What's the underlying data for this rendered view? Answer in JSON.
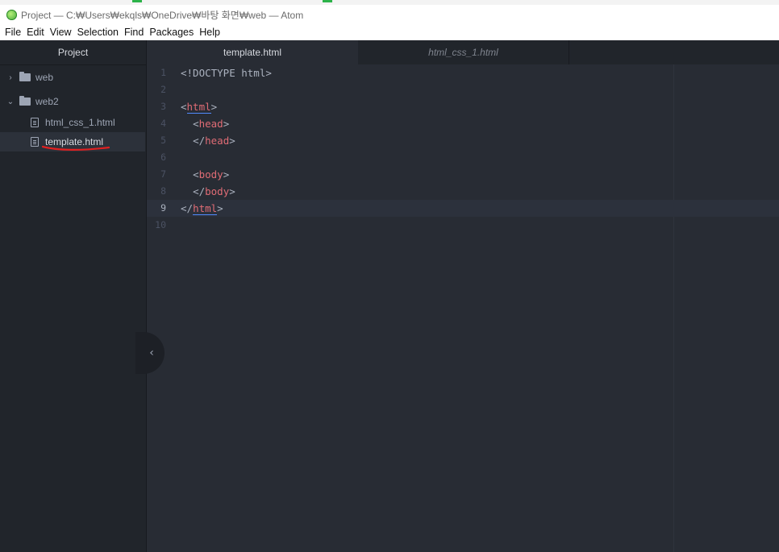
{
  "window": {
    "title": "Project — C:₩Users₩ekqls₩OneDrive₩바탕 화면₩web — Atom"
  },
  "menubar": {
    "items": [
      "File",
      "Edit",
      "View",
      "Selection",
      "Find",
      "Packages",
      "Help"
    ]
  },
  "tree": {
    "header": "Project",
    "items": [
      {
        "type": "folder",
        "label": "web",
        "expanded": false
      },
      {
        "type": "folder",
        "label": "web2",
        "expanded": true
      },
      {
        "type": "file",
        "label": "html_css_1.html"
      },
      {
        "type": "file",
        "label": "template.html",
        "selected": true
      }
    ]
  },
  "tabs": [
    {
      "label": "template.html",
      "active": true
    },
    {
      "label": "html_css_1.html",
      "active": false
    }
  ],
  "editor": {
    "line_numbers": [
      "1",
      "2",
      "3",
      "4",
      "5",
      "6",
      "7",
      "8",
      "9",
      "10"
    ],
    "cursor_line": 9,
    "lines": {
      "l1": "<!DOCTYPE html>",
      "l3_tag": "html",
      "l4_tag": "head",
      "l5_tag": "head",
      "l7_tag": "body",
      "l8_tag": "body",
      "l9_tag": "html"
    }
  },
  "colors": {
    "background": "#282c34",
    "sidebar": "#21252b",
    "tag": "#e06c75",
    "text": "#abb2bf",
    "annotation": "#e02020"
  }
}
